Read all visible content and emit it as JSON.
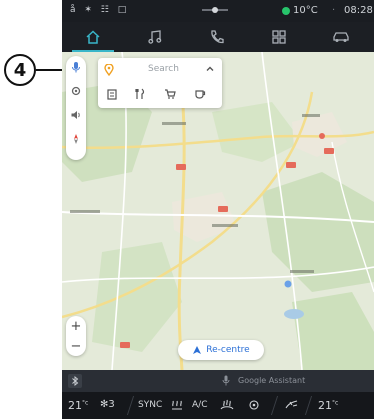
{
  "callout": {
    "number": "4"
  },
  "status_bar": {
    "icons": "å ✶ ☷ □",
    "temperature": "10°C",
    "separator": "·",
    "time": "08:28"
  },
  "top_nav": {
    "items": [
      {
        "name": "home-icon",
        "active": true
      },
      {
        "name": "music-icon",
        "active": false
      },
      {
        "name": "phone-icon",
        "active": false
      },
      {
        "name": "apps-icon",
        "active": false
      },
      {
        "name": "car-icon",
        "active": false
      }
    ]
  },
  "map": {
    "search_placeholder": "Search",
    "categories": [
      "hotel-icon",
      "restaurant-icon",
      "shopping-icon",
      "cafe-icon"
    ],
    "zoom_in_label": "+",
    "zoom_out_label": "−",
    "recentre_label": "Re-centre"
  },
  "assistant_bar": {
    "label": "Google Assistant"
  },
  "climate_bar": {
    "left_temp": "21",
    "left_unit": "°c",
    "fan_level": "3",
    "sync_label": "SYNC",
    "ac_label": "A/C",
    "right_temp": "21",
    "right_unit": "°c"
  },
  "colors": {
    "accent": "#39b6c9",
    "screen_bg": "#1a1d22",
    "map_bg": "#e6ebdc",
    "link": "#2b6fd6",
    "status_green": "#27c46b"
  }
}
